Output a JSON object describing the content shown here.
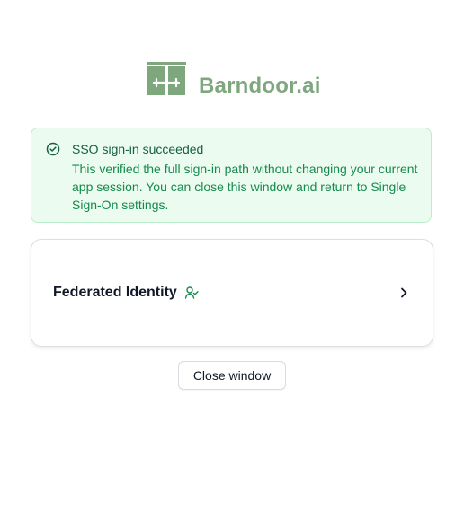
{
  "brand": {
    "name": "Barndoor.ai",
    "logo_icon": "barn-door-logo-icon",
    "color": "#7fa77e"
  },
  "alert": {
    "icon": "check-circle-icon",
    "title": "SSO sign-in succeeded",
    "message": "This verified the full sign-in path without changing your current app session. You can close this window and return to Single Sign-On settings.",
    "background": "#ebfbef",
    "border": "#b9eecb",
    "text_color": "#168a4d"
  },
  "identity_card": {
    "title": "Federated Identity",
    "icon": "user-check-icon",
    "action_icon": "chevron-right-icon"
  },
  "actions": {
    "close_label": "Close window"
  }
}
